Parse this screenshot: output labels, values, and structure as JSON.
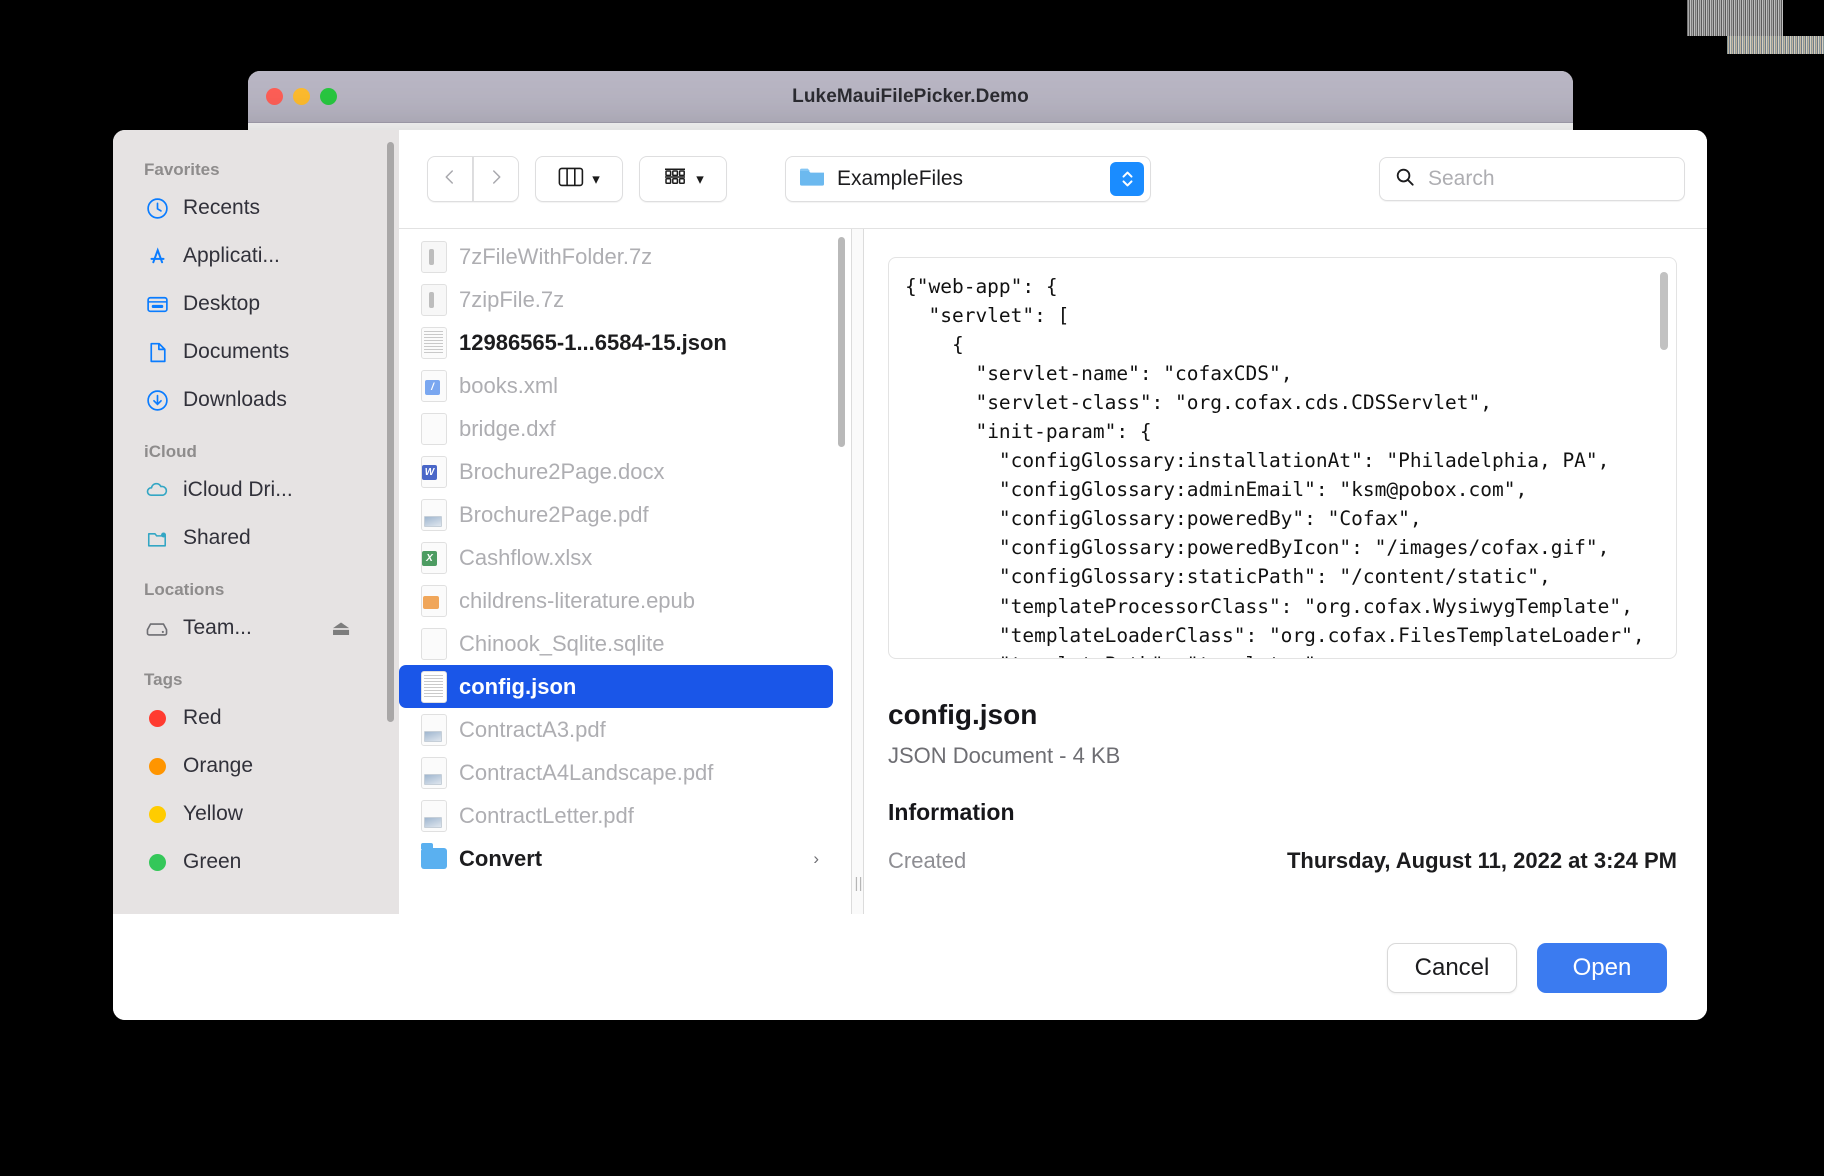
{
  "window": {
    "title": "LukeMauiFilePicker.Demo",
    "traffic_lights": [
      "close-button",
      "minimize-button",
      "zoom-button"
    ]
  },
  "sidebar": {
    "sections": [
      {
        "header": "Favorites",
        "items": [
          {
            "label": "Recents",
            "icon": "clock-icon"
          },
          {
            "label": "Applicati...",
            "icon": "app-store-icon"
          },
          {
            "label": "Desktop",
            "icon": "desktop-icon"
          },
          {
            "label": "Documents",
            "icon": "document-icon"
          },
          {
            "label": "Downloads",
            "icon": "download-icon"
          }
        ]
      },
      {
        "header": "iCloud",
        "items": [
          {
            "label": "iCloud Dri...",
            "icon": "cloud-icon"
          },
          {
            "label": "Shared",
            "icon": "shared-folder-icon"
          }
        ]
      },
      {
        "header": "Locations",
        "items": [
          {
            "label": "Team...",
            "icon": "hard-drive-icon",
            "eject": "⏏"
          }
        ]
      },
      {
        "header": "Tags",
        "items": [
          {
            "label": "Red",
            "icon": "tag-dot-icon",
            "color": "#ff3b30"
          },
          {
            "label": "Orange",
            "icon": "tag-dot-icon",
            "color": "#ff9500"
          },
          {
            "label": "Yellow",
            "icon": "tag-dot-icon",
            "color": "#ffcc00"
          },
          {
            "label": "Green",
            "icon": "tag-dot-icon",
            "color": "#34c759"
          }
        ]
      }
    ]
  },
  "toolbar": {
    "back_icon": "chevron-left-icon",
    "forward_icon": "chevron-right-icon",
    "view_icon": "column-view-icon",
    "view_chevron": "chevron-down-icon",
    "group_icon": "group-by-icon",
    "group_chevron": "chevron-down-icon",
    "path": {
      "folder_icon": "folder-icon",
      "name": "ExampleFiles",
      "stepper_icon": "up-down-stepper-icon"
    },
    "search": {
      "icon": "search-icon",
      "placeholder": "Search",
      "value": ""
    }
  },
  "filelist": {
    "items": [
      {
        "name": "7zFileWithFolder.7z",
        "icon": "archive-file-icon",
        "state": "dim"
      },
      {
        "name": "7zipFile.7z",
        "icon": "archive-file-icon",
        "state": "dim"
      },
      {
        "name": "12986565-1...6584-15.json",
        "icon": "json-file-icon",
        "state": "enabled"
      },
      {
        "name": "books.xml",
        "icon": "xml-file-icon",
        "state": "dim"
      },
      {
        "name": "bridge.dxf",
        "icon": "generic-file-icon",
        "state": "dim"
      },
      {
        "name": "Brochure2Page.docx",
        "icon": "word-file-icon",
        "state": "dim"
      },
      {
        "name": "Brochure2Page.pdf",
        "icon": "pdf-file-icon",
        "state": "dim"
      },
      {
        "name": "Cashflow.xlsx",
        "icon": "excel-file-icon",
        "state": "dim"
      },
      {
        "name": "childrens-literature.epub",
        "icon": "epub-file-icon",
        "state": "dim"
      },
      {
        "name": "Chinook_Sqlite.sqlite",
        "icon": "generic-file-icon",
        "state": "dim"
      },
      {
        "name": "config.json",
        "icon": "json-file-icon",
        "state": "selected"
      },
      {
        "name": "ContractA3.pdf",
        "icon": "pdf-file-icon",
        "state": "dim"
      },
      {
        "name": "ContractA4Landscape.pdf",
        "icon": "pdf-file-icon",
        "state": "dim"
      },
      {
        "name": "ContractLetter.pdf",
        "icon": "pdf-file-icon",
        "state": "dim"
      },
      {
        "name": "Convert",
        "icon": "folder-icon",
        "state": "folder",
        "chevron": "›"
      }
    ]
  },
  "preview": {
    "code": "{\"web-app\": {\n  \"servlet\": [\n    {\n      \"servlet-name\": \"cofaxCDS\",\n      \"servlet-class\": \"org.cofax.cds.CDSServlet\",\n      \"init-param\": {\n        \"configGlossary:installationAt\": \"Philadelphia, PA\",\n        \"configGlossary:adminEmail\": \"ksm@pobox.com\",\n        \"configGlossary:poweredBy\": \"Cofax\",\n        \"configGlossary:poweredByIcon\": \"/images/cofax.gif\",\n        \"configGlossary:staticPath\": \"/content/static\",\n        \"templateProcessorClass\": \"org.cofax.WysiwygTemplate\",\n        \"templateLoaderClass\": \"org.cofax.FilesTemplateLoader\",\n        \"templatePath\": \"templates\",\n        \"templateOverridePath\": \"\",",
    "filename": "config.json",
    "kind_size": "JSON Document - 4 KB",
    "information_header": "Information",
    "info_rows": [
      {
        "key": "Created",
        "value": "Thursday, August 11, 2022 at 3:24 PM"
      }
    ]
  },
  "footer": {
    "cancel_label": "Cancel",
    "open_label": "Open"
  },
  "colors": {
    "accent": "#1a56e8",
    "open_button": "#3b7bf0",
    "stepper": "#1a8cff",
    "sidebar_bg": "#e6e3e3"
  }
}
